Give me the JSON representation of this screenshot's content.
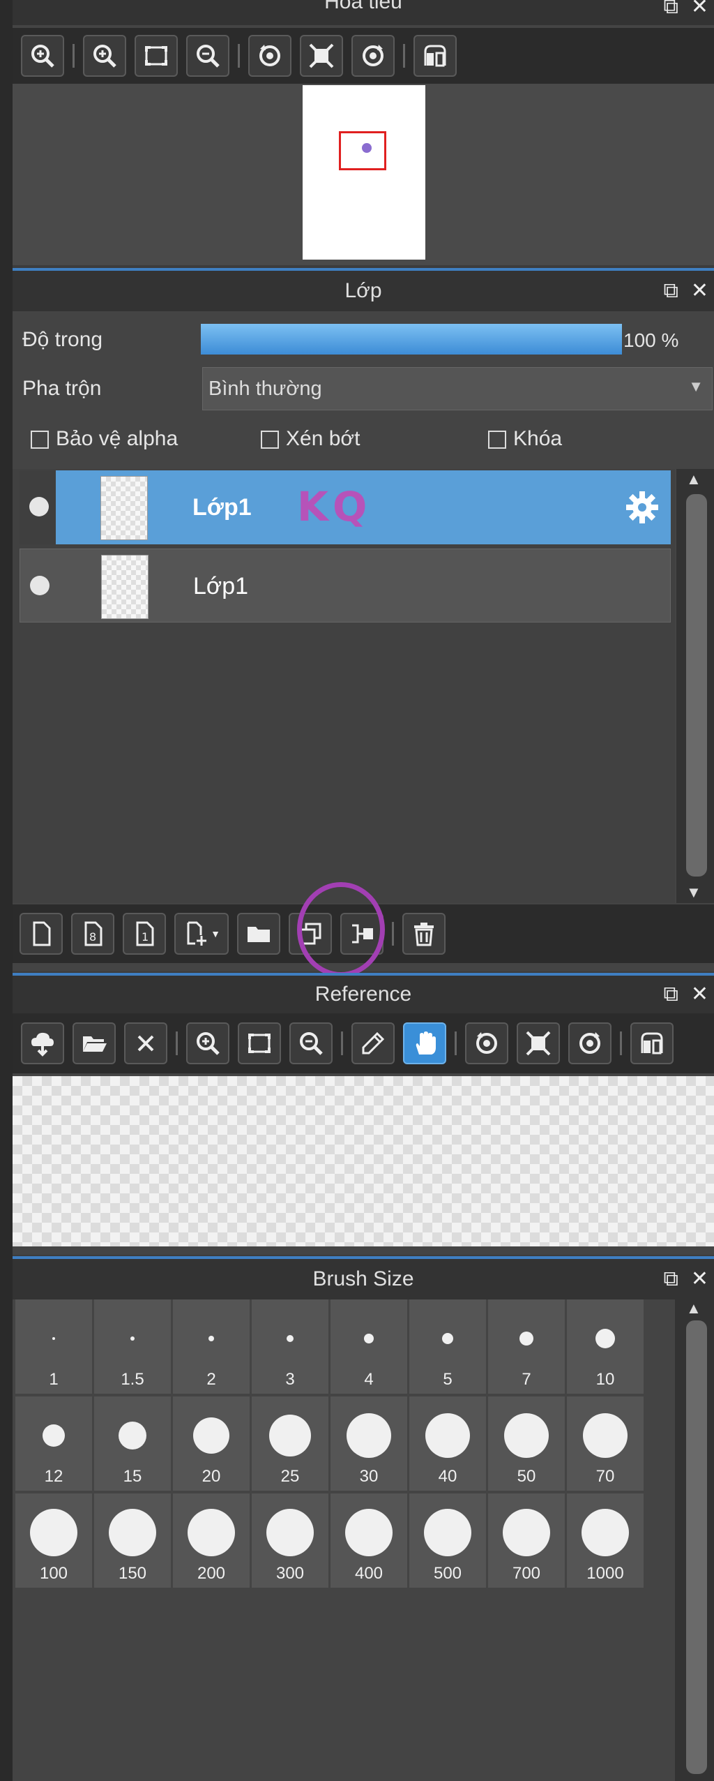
{
  "navigator": {
    "title": "Hoa tiêu",
    "tools": [
      "zoom-in-fit-icon",
      "zoom-in-icon",
      "fit-screen-icon",
      "zoom-out-icon",
      "rotate-left-icon",
      "reset-view-icon",
      "rotate-right-icon",
      "flip-icon"
    ]
  },
  "layers": {
    "title": "Lớp",
    "opacity_label": "Độ trong",
    "opacity_value": "100 %",
    "opacity_fraction": 1.0,
    "blend_label": "Pha trộn",
    "blend_value": "Bình thường",
    "protect_alpha": "Bảo vệ alpha",
    "clipping": "Xén bớt",
    "lock": "Khóa",
    "items": [
      {
        "name": "Lớp1",
        "selected": true
      },
      {
        "name": "Lớp1",
        "selected": false
      }
    ],
    "annotation": "KQ",
    "accent": "#5a9fd8"
  },
  "reference": {
    "title": "Reference"
  },
  "brush_size": {
    "title": "Brush Size",
    "sizes": [
      "1",
      "1.5",
      "2",
      "3",
      "4",
      "5",
      "7",
      "10",
      "12",
      "15",
      "20",
      "25",
      "30",
      "40",
      "50",
      "70",
      "100",
      "150",
      "200",
      "300",
      "400",
      "500",
      "700",
      "1000"
    ]
  }
}
